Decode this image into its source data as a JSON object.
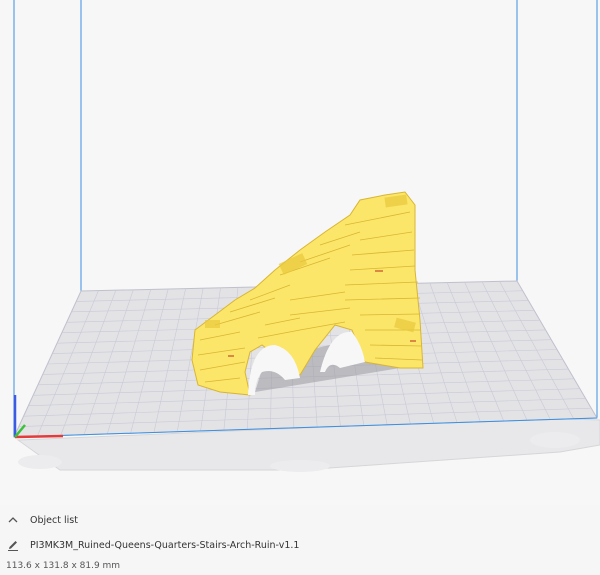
{
  "object_list": {
    "header_label": "Object list",
    "header_icon": "chevron-up-icon",
    "file_icon": "pencil-icon",
    "file_name": "PI3MK3M_Ruined-Queens-Quarters-Stairs-Arch-Ruin-v1.1",
    "dimensions": "113.6 x 131.8 x 81.9 mm"
  },
  "colors": {
    "model": "#fbe66a",
    "model_shadow": "#e9c93c",
    "build_plate": "#e3e3e6",
    "grid_line": "#c8c9d6",
    "volume_edge": "#3b8fe3",
    "axis_x": "#e33b3b",
    "axis_y": "#3bc23b",
    "axis_z": "#3b5be3"
  }
}
